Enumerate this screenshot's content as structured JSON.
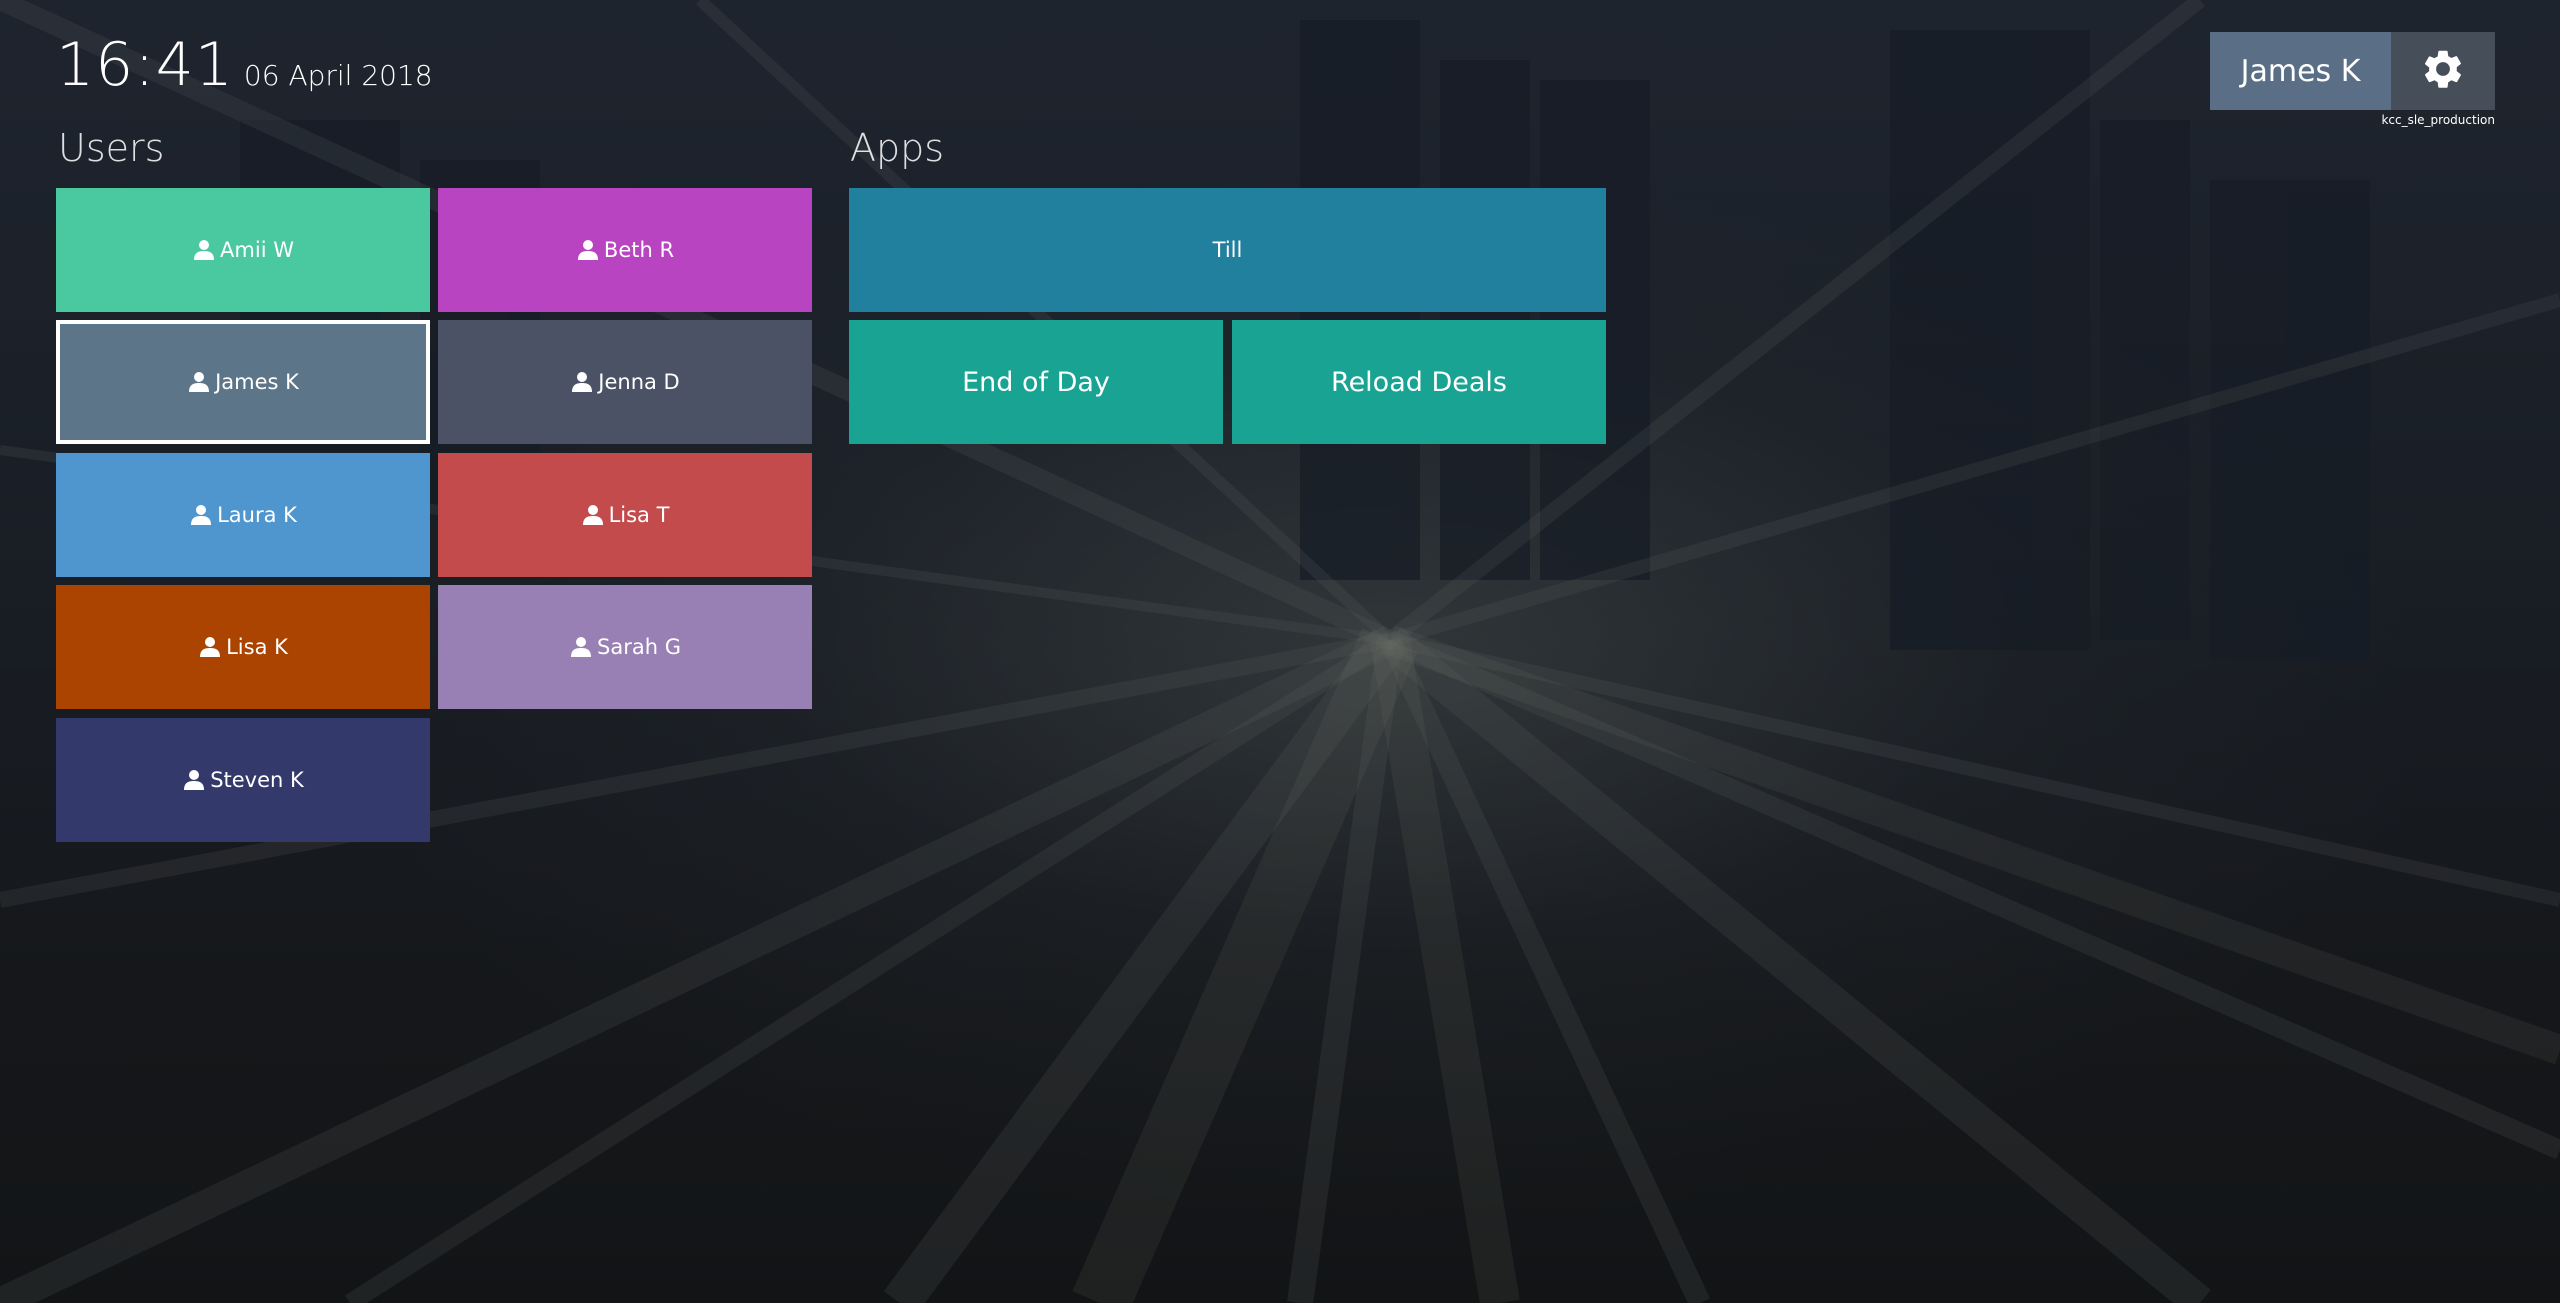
{
  "clock": {
    "time": "16:41",
    "date": "06 April 2018"
  },
  "sections": {
    "users": "Users",
    "apps": "Apps"
  },
  "users": [
    {
      "label": "Amii W",
      "color": "#4ac9a1"
    },
    {
      "label": "Beth R",
      "color": "#b944c2"
    },
    {
      "label": "James K",
      "color": "#5d7589",
      "selected": true
    },
    {
      "label": "Jenna D",
      "color": "#4b5266"
    },
    {
      "label": "Laura K",
      "color": "#4f96cf"
    },
    {
      "label": "Lisa T",
      "color": "#c34b4c"
    },
    {
      "label": "Lisa K",
      "color": "#ab4400"
    },
    {
      "label": "Sarah G",
      "color": "#9880b4"
    },
    {
      "label": "Steven K",
      "color": "#33396b"
    }
  ],
  "apps": [
    {
      "label": "Till",
      "color": "#20809e"
    },
    {
      "label": "End of Day",
      "color": "#18a393"
    },
    {
      "label": "Reload Deals",
      "color": "#18a393"
    }
  ],
  "header": {
    "current_user": "James K",
    "settings_icon": "gear-icon",
    "environment": "kcc_sle_production"
  }
}
